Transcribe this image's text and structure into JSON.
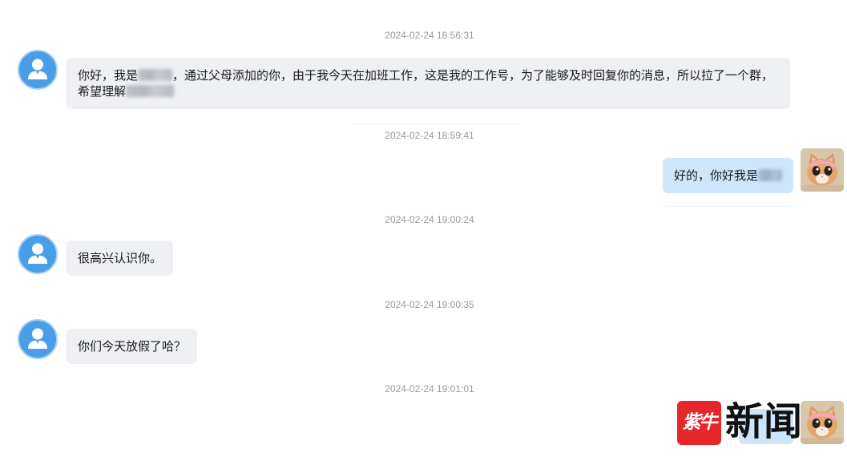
{
  "theme": {
    "left_bubble_color": "#eef0f4",
    "right_bubble_color": "#cde6fb",
    "avatar_blue": "#4a9ee8",
    "timestamp_color": "#9a9a9a",
    "logo_red": "#e5262b"
  },
  "conversation": [
    {
      "timestamp": "2024-02-24 18:56:31",
      "avatar": "default-user-icon",
      "parts": [
        "你好，我是",
        "，通过父母添加的你，由于我今天在加班工作，这是我的工作号，为了能够及时回复你的消息，所以拉了一个群，",
        "希望理解"
      ]
    },
    {
      "timestamp": "2024-02-24 18:59:41",
      "avatar": "cat-avatar-icon",
      "parts": [
        "好的，你好我是"
      ]
    },
    {
      "timestamp": "2024-02-24 19:00:24",
      "avatar": "default-user-icon",
      "parts": [
        "很高兴认识你。"
      ]
    },
    {
      "timestamp": "2024-02-24 19:00:35",
      "avatar": "default-user-icon",
      "parts": [
        "你们今天放假了哈？"
      ]
    },
    {
      "timestamp": "2024-02-24 19:01:01",
      "avatar": "cat-avatar-icon",
      "parts": []
    }
  ],
  "watermark": {
    "logo_mark": "紫牛",
    "logo_text": "新闻"
  }
}
